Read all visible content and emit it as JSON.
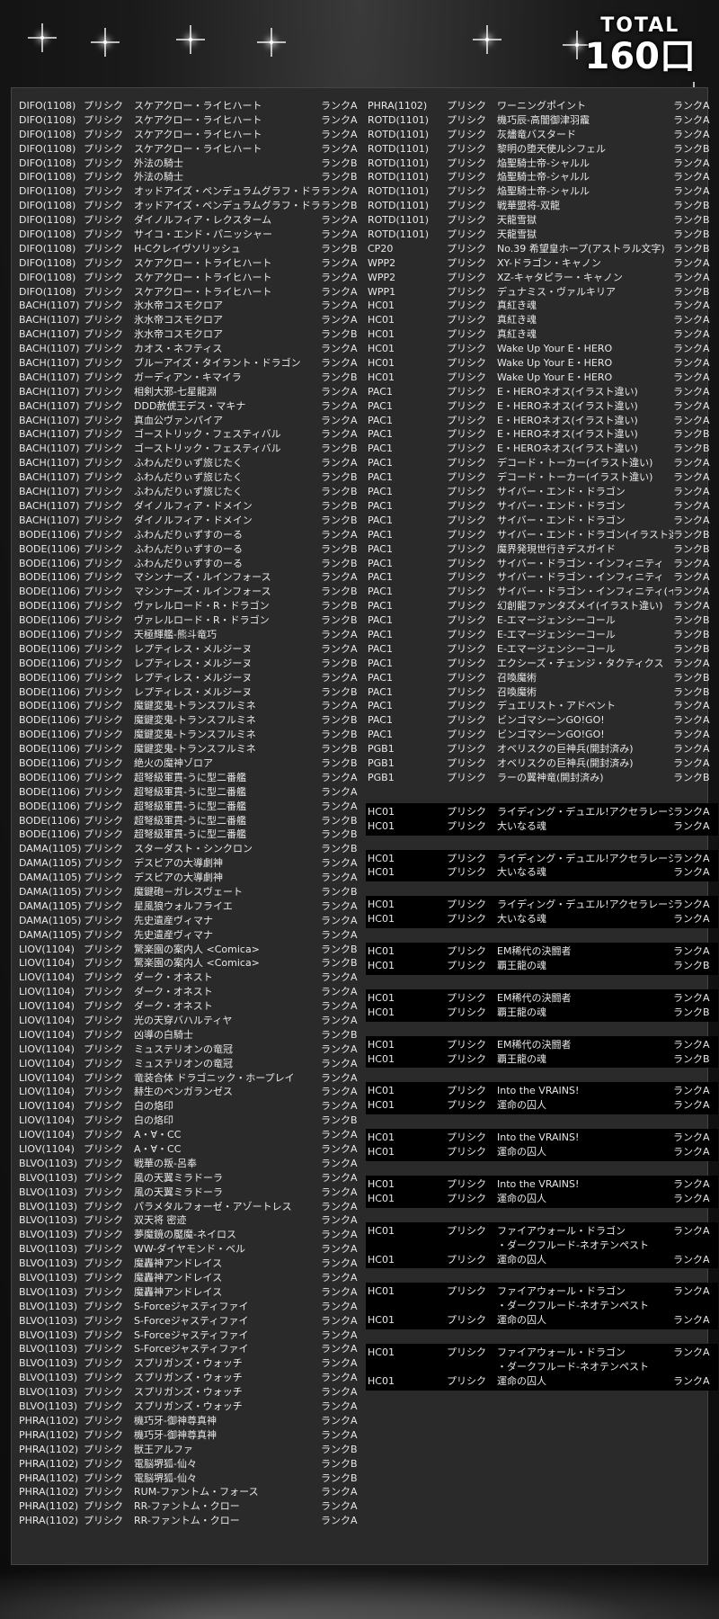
{
  "total": {
    "label": "TOTAL",
    "count": "160口"
  },
  "left_rows": [
    [
      "DIFO(1108)",
      "プリシク",
      "スケアクロー・ライヒハート",
      "ランクA"
    ],
    [
      "DIFO(1108)",
      "プリシク",
      "スケアクロー・ライヒハート",
      "ランクA"
    ],
    [
      "DIFO(1108)",
      "プリシク",
      "スケアクロー・ライヒハート",
      "ランクA"
    ],
    [
      "DIFO(1108)",
      "プリシク",
      "スケアクロー・ライヒハート",
      "ランクA"
    ],
    [
      "DIFO(1108)",
      "プリシク",
      "外法の騎士",
      "ランクB"
    ],
    [
      "DIFO(1108)",
      "プリシク",
      "外法の騎士",
      "ランクB"
    ],
    [
      "DIFO(1108)",
      "プリシク",
      "オッドアイズ・ペンデュラムグラフ・ドラゴン",
      "ランクA"
    ],
    [
      "DIFO(1108)",
      "プリシク",
      "オッドアイズ・ペンデュラムグラフ・ドラゴン",
      "ランクB"
    ],
    [
      "DIFO(1108)",
      "プリシク",
      "ダイノルフィア・レクスターム",
      "ランクA"
    ],
    [
      "DIFO(1108)",
      "プリシク",
      "サイコ・エンド・パニッシャー",
      "ランクA"
    ],
    [
      "DIFO(1108)",
      "プリシク",
      "H-Cクレイヴソリッシュ",
      "ランクB"
    ],
    [
      "DIFO(1108)",
      "プリシク",
      "スケアクロー・トライヒハート",
      "ランクA"
    ],
    [
      "DIFO(1108)",
      "プリシク",
      "スケアクロー・トライヒハート",
      "ランクA"
    ],
    [
      "DIFO(1108)",
      "プリシク",
      "スケアクロー・トライヒハート",
      "ランクA"
    ],
    [
      "BACH(1107)",
      "プリシク",
      "氷水帝コスモクロア",
      "ランクA"
    ],
    [
      "BACH(1107)",
      "プリシク",
      "氷水帝コスモクロア",
      "ランクA"
    ],
    [
      "BACH(1107)",
      "プリシク",
      "氷水帝コスモクロア",
      "ランクB"
    ],
    [
      "BACH(1107)",
      "プリシク",
      "カオス・ネフティス",
      "ランクA"
    ],
    [
      "BACH(1107)",
      "プリシク",
      "ブルーアイズ・タイラント・ドラゴン",
      "ランクA"
    ],
    [
      "BACH(1107)",
      "プリシク",
      "ガーディアン・キマイラ",
      "ランクB"
    ],
    [
      "BACH(1107)",
      "プリシク",
      "相剣大邪-七星龍淵",
      "ランクA"
    ],
    [
      "BACH(1107)",
      "プリシク",
      "DDD赦俿王デス・マキナ",
      "ランクA"
    ],
    [
      "BACH(1107)",
      "プリシク",
      "真血公ヴァンパイア",
      "ランクA"
    ],
    [
      "BACH(1107)",
      "プリシク",
      "ゴーストリック・フェスティバル",
      "ランクA"
    ],
    [
      "BACH(1107)",
      "プリシク",
      "ゴーストリック・フェスティバル",
      "ランクB"
    ],
    [
      "BACH(1107)",
      "プリシク",
      "ふわんだりぃず旅じたく",
      "ランクA"
    ],
    [
      "BACH(1107)",
      "プリシク",
      "ふわんだりぃず旅じたく",
      "ランクB"
    ],
    [
      "BACH(1107)",
      "プリシク",
      "ふわんだりぃず旅じたく",
      "ランクB"
    ],
    [
      "BACH(1107)",
      "プリシク",
      "ダイノルフィア・ドメイン",
      "ランクB"
    ],
    [
      "BACH(1107)",
      "プリシク",
      "ダイノルフィア・ドメイン",
      "ランクB"
    ],
    [
      "BODE(1106)",
      "プリシク",
      "ふわんだりぃずすのーる",
      "ランクA"
    ],
    [
      "BODE(1106)",
      "プリシク",
      "ふわんだりぃずすのーる",
      "ランクB"
    ],
    [
      "BODE(1106)",
      "プリシク",
      "ふわんだりぃずすのーる",
      "ランクB"
    ],
    [
      "BODE(1106)",
      "プリシク",
      "マシンナーズ・ルインフォース",
      "ランクA"
    ],
    [
      "BODE(1106)",
      "プリシク",
      "マシンナーズ・ルインフォース",
      "ランクB"
    ],
    [
      "BODE(1106)",
      "プリシク",
      "ヴァレルロード・R・ドラゴン",
      "ランクB"
    ],
    [
      "BODE(1106)",
      "プリシク",
      "ヴァレルロード・R・ドラゴン",
      "ランクB"
    ],
    [
      "BODE(1106)",
      "プリシク",
      "天極輝艦-熊斗竜巧",
      "ランクA"
    ],
    [
      "BODE(1106)",
      "プリシク",
      "レプティレス・メルジーヌ",
      "ランクA"
    ],
    [
      "BODE(1106)",
      "プリシク",
      "レプティレス・メルジーヌ",
      "ランクB"
    ],
    [
      "BODE(1106)",
      "プリシク",
      "レプティレス・メルジーヌ",
      "ランクA"
    ],
    [
      "BODE(1106)",
      "プリシク",
      "レプティレス・メルジーヌ",
      "ランクB"
    ],
    [
      "BODE(1106)",
      "プリシク",
      "魔鍵変鬼-トランスフルミネ",
      "ランクA"
    ],
    [
      "BODE(1106)",
      "プリシク",
      "魔鍵変鬼-トランスフルミネ",
      "ランクB"
    ],
    [
      "BODE(1106)",
      "プリシク",
      "魔鍵変鬼-トランスフルミネ",
      "ランクB"
    ],
    [
      "BODE(1106)",
      "プリシク",
      "魔鍵変鬼-トランスフルミネ",
      "ランクB"
    ],
    [
      "BODE(1106)",
      "プリシク",
      "絶火の魔神ゾロア",
      "ランクB"
    ],
    [
      "BODE(1106)",
      "プリシク",
      "超弩級軍貫-うに型二番艦",
      "ランクA"
    ],
    [
      "BODE(1106)",
      "プリシク",
      "超弩級軍貫-うに型二番艦",
      "ランクA"
    ],
    [
      "BODE(1106)",
      "プリシク",
      "超弩級軍貫-うに型二番艦",
      "ランクA"
    ],
    [
      "BODE(1106)",
      "プリシク",
      "超弩級軍貫-うに型二番艦",
      "ランクB"
    ],
    [
      "BODE(1106)",
      "プリシク",
      "超弩級軍貫-うに型二番艦",
      "ランクB"
    ],
    [
      "DAMA(1105)",
      "プリシク",
      "スターダスト・シンクロン",
      "ランクB"
    ],
    [
      "DAMA(1105)",
      "プリシク",
      "デスピアの大導劇神",
      "ランクA"
    ],
    [
      "DAMA(1105)",
      "プリシク",
      "デスピアの大導劇神",
      "ランクA"
    ],
    [
      "DAMA(1105)",
      "プリシク",
      "魔鍵砲－ガレスヴェート",
      "ランクB"
    ],
    [
      "DAMA(1105)",
      "プリシク",
      "星風狼ウォルフライエ",
      "ランクA"
    ],
    [
      "DAMA(1105)",
      "プリシク",
      "先史遺産ヴィマナ",
      "ランクA"
    ],
    [
      "DAMA(1105)",
      "プリシク",
      "先史遺産ヴィマナ",
      "ランクA"
    ],
    [
      "LIOV(1104)",
      "プリシク",
      "驚楽園の案内人 <Comica>",
      "ランクB"
    ],
    [
      "LIOV(1104)",
      "プリシク",
      "驚楽園の案内人 <Comica>",
      "ランクB"
    ],
    [
      "LIOV(1104)",
      "プリシク",
      "ダーク・オネスト",
      "ランクA"
    ],
    [
      "LIOV(1104)",
      "プリシク",
      "ダーク・オネスト",
      "ランクA"
    ],
    [
      "LIOV(1104)",
      "プリシク",
      "ダーク・オネスト",
      "ランクA"
    ],
    [
      "LIOV(1104)",
      "プリシク",
      "光の天穿バハルティヤ",
      "ランクA"
    ],
    [
      "LIOV(1104)",
      "プリシク",
      "凶導の白騎士",
      "ランクB"
    ],
    [
      "LIOV(1104)",
      "プリシク",
      "ミュステリオンの竜冠",
      "ランクA"
    ],
    [
      "LIOV(1104)",
      "プリシク",
      "ミュステリオンの竜冠",
      "ランクA"
    ],
    [
      "LIOV(1104)",
      "プリシク",
      "竜装合体 ドラゴニック・ホープレイ",
      "ランクA"
    ],
    [
      "LIOV(1104)",
      "プリシク",
      "赫生のベンガランゼス",
      "ランクA"
    ],
    [
      "LIOV(1104)",
      "プリシク",
      "白の烙印",
      "ランクA"
    ],
    [
      "LIOV(1104)",
      "プリシク",
      "白の烙印",
      "ランクB"
    ],
    [
      "LIOV(1104)",
      "プリシク",
      "A・∀・CC",
      "ランクA"
    ],
    [
      "LIOV(1104)",
      "プリシク",
      "A・∀・CC",
      "ランクA"
    ],
    [
      "BLVO(1103)",
      "プリシク",
      "戦華の叛-呂奉",
      "ランクA"
    ],
    [
      "BLVO(1103)",
      "プリシク",
      "風の天翼ミラドーラ",
      "ランクA"
    ],
    [
      "BLVO(1103)",
      "プリシク",
      "風の天翼ミラドーラ",
      "ランクA"
    ],
    [
      "BLVO(1103)",
      "プリシク",
      "パラメタルフォーゼ・アゾートレス",
      "ランクA"
    ],
    [
      "BLVO(1103)",
      "プリシク",
      "双天将 密迹",
      "ランクA"
    ],
    [
      "BLVO(1103)",
      "プリシク",
      "夢魔鏡の魘魔-ネイロス",
      "ランクA"
    ],
    [
      "BLVO(1103)",
      "プリシク",
      "WW-ダイヤモンド・ベル",
      "ランクA"
    ],
    [
      "BLVO(1103)",
      "プリシク",
      "魔轟神アンドレイス",
      "ランクA"
    ],
    [
      "BLVO(1103)",
      "プリシク",
      "魔轟神アンドレイス",
      "ランクA"
    ],
    [
      "BLVO(1103)",
      "プリシク",
      "魔轟神アンドレイス",
      "ランクA"
    ],
    [
      "BLVO(1103)",
      "プリシク",
      "S-Forceジャスティファイ",
      "ランクA"
    ],
    [
      "BLVO(1103)",
      "プリシク",
      "S-Forceジャスティファイ",
      "ランクA"
    ],
    [
      "BLVO(1103)",
      "プリシク",
      "S-Forceジャスティファイ",
      "ランクA"
    ],
    [
      "BLVO(1103)",
      "プリシク",
      "S-Forceジャスティファイ",
      "ランクA"
    ],
    [
      "BLVO(1103)",
      "プリシク",
      "スプリガンズ・ウォッチ",
      "ランクA"
    ],
    [
      "BLVO(1103)",
      "プリシク",
      "スプリガンズ・ウォッチ",
      "ランクA"
    ],
    [
      "BLVO(1103)",
      "プリシク",
      "スプリガンズ・ウォッチ",
      "ランクA"
    ],
    [
      "BLVO(1103)",
      "プリシク",
      "スプリガンズ・ウォッチ",
      "ランクA"
    ],
    [
      "PHRA(1102)",
      "プリシク",
      "機巧牙-御神尊真神",
      "ランクA"
    ],
    [
      "PHRA(1102)",
      "プリシク",
      "機巧牙-御神尊真神",
      "ランクA"
    ],
    [
      "PHRA(1102)",
      "プリシク",
      "獣王アルファ",
      "ランクB"
    ],
    [
      "PHRA(1102)",
      "プリシク",
      "電脳堺狐-仙々",
      "ランクB"
    ],
    [
      "PHRA(1102)",
      "プリシク",
      "電脳堺狐-仙々",
      "ランクB"
    ],
    [
      "PHRA(1102)",
      "プリシク",
      "RUM-ファントム・フォース",
      "ランクA"
    ],
    [
      "PHRA(1102)",
      "プリシク",
      "RR-ファントム・クロー",
      "ランクA"
    ],
    [
      "PHRA(1102)",
      "プリシク",
      "RR-ファントム・クロー",
      "ランクA"
    ]
  ],
  "right_rows": [
    [
      "PHRA(1102)",
      "プリシク",
      "ワーニングポイント",
      "ランクA"
    ],
    [
      "ROTD(1101)",
      "プリシク",
      "機巧辰-高闇御津羽靇",
      "ランクA"
    ],
    [
      "ROTD(1101)",
      "プリシク",
      "灰燼竜バスタード",
      "ランクA"
    ],
    [
      "ROTD(1101)",
      "プリシク",
      "黎明の堕天使ルシフェル",
      "ランクB"
    ],
    [
      "ROTD(1101)",
      "プリシク",
      "焔聖騎士帝-シャルル",
      "ランクA"
    ],
    [
      "ROTD(1101)",
      "プリシク",
      "焔聖騎士帝-シャルル",
      "ランクA"
    ],
    [
      "ROTD(1101)",
      "プリシク",
      "焔聖騎士帝-シャルル",
      "ランクA"
    ],
    [
      "ROTD(1101)",
      "プリシク",
      "戦華盟将-双龍",
      "ランクB"
    ],
    [
      "ROTD(1101)",
      "プリシク",
      "天龍雪獄",
      "ランクB"
    ],
    [
      "ROTD(1101)",
      "プリシク",
      "天龍雪獄",
      "ランクB"
    ],
    [
      "CP20",
      "プリシク",
      "No.39 希望皇ホープ(アストラル文字)",
      "ランクB"
    ],
    [
      "WPP2",
      "プリシク",
      "XY-ドラゴン・キャノン",
      "ランクA"
    ],
    [
      "WPP2",
      "プリシク",
      "XZ-キャタピラー・キャノン",
      "ランクA"
    ],
    [
      "WPP1",
      "プリシク",
      "デュナミス・ヴァルキリア",
      "ランクB"
    ],
    [
      "HC01",
      "プリシク",
      "真紅き魂",
      "ランクA"
    ],
    [
      "HC01",
      "プリシク",
      "真紅き魂",
      "ランクA"
    ],
    [
      "HC01",
      "プリシク",
      "真紅き魂",
      "ランクA"
    ],
    [
      "HC01",
      "プリシク",
      "Wake Up Your E・HERO",
      "ランクA"
    ],
    [
      "HC01",
      "プリシク",
      "Wake Up Your E・HERO",
      "ランクA"
    ],
    [
      "HC01",
      "プリシク",
      "Wake Up Your E・HERO",
      "ランクA"
    ],
    [
      "PAC1",
      "プリシク",
      "E・HEROネオス(イラスト違い)",
      "ランクA"
    ],
    [
      "PAC1",
      "プリシク",
      "E・HEROネオス(イラスト違い)",
      "ランクA"
    ],
    [
      "PAC1",
      "プリシク",
      "E・HEROネオス(イラスト違い)",
      "ランクA"
    ],
    [
      "PAC1",
      "プリシク",
      "E・HEROネオス(イラスト違い)",
      "ランクB"
    ],
    [
      "PAC1",
      "プリシク",
      "E・HEROネオス(イラスト違い)",
      "ランクB"
    ],
    [
      "PAC1",
      "プリシク",
      "デコード・トーカー(イラスト違い)",
      "ランクA"
    ],
    [
      "PAC1",
      "プリシク",
      "デコード・トーカー(イラスト違い)",
      "ランクA"
    ],
    [
      "PAC1",
      "プリシク",
      "サイバー・エンド・ドラゴン",
      "ランクA"
    ],
    [
      "PAC1",
      "プリシク",
      "サイバー・エンド・ドラゴン",
      "ランクA"
    ],
    [
      "PAC1",
      "プリシク",
      "サイバー・エンド・ドラゴン",
      "ランクA"
    ],
    [
      "PAC1",
      "プリシク",
      "サイバー・エンド・ドラゴン(イラスト違い)",
      "ランクB"
    ],
    [
      "PAC1",
      "プリシク",
      "魔界発現世行きデスガイド",
      "ランクB"
    ],
    [
      "PAC1",
      "プリシク",
      "サイバー・ドラゴン・インフィニティ",
      "ランクA"
    ],
    [
      "PAC1",
      "プリシク",
      "サイバー・ドラゴン・インフィニティ",
      "ランクA"
    ],
    [
      "PAC1",
      "プリシク",
      "サイバー・ドラゴン・インフィニティ(イラスト違い)",
      "ランクA"
    ],
    [
      "PAC1",
      "プリシク",
      "幻創龍ファンタズメイ(イラスト違い)",
      "ランクA"
    ],
    [
      "PAC1",
      "プリシク",
      "E-エマージェンシーコール",
      "ランクB"
    ],
    [
      "PAC1",
      "プリシク",
      "E-エマージェンシーコール",
      "ランクB"
    ],
    [
      "PAC1",
      "プリシク",
      "E-エマージェンシーコール",
      "ランクB"
    ],
    [
      "PAC1",
      "プリシク",
      "エクシーズ・チェンジ・タクティクス",
      "ランクA"
    ],
    [
      "PAC1",
      "プリシク",
      "召喚魔術",
      "ランクB"
    ],
    [
      "PAC1",
      "プリシク",
      "召喚魔術",
      "ランクB"
    ],
    [
      "PAC1",
      "プリシク",
      "デュエリスト・アドベント",
      "ランクA"
    ],
    [
      "PAC1",
      "プリシク",
      "ビンゴマシーンGO!GO!",
      "ランクA"
    ],
    [
      "PAC1",
      "プリシク",
      "ビンゴマシーンGO!GO!",
      "ランクA"
    ],
    [
      "PGB1",
      "プリシク",
      "オベリスクの巨神兵(開封済み)",
      "ランクA"
    ],
    [
      "PGB1",
      "プリシク",
      "オベリスクの巨神兵(開封済み)",
      "ランクA"
    ],
    [
      "PGB1",
      "プリシク",
      "ラーの翼神竜(開封済み)",
      "ランクB"
    ]
  ],
  "groups": [
    [
      [
        "HC01",
        "プリシク",
        "ライディング・デュエル!アクセラレーション!",
        "ランクA"
      ],
      [
        "HC01",
        "プリシク",
        "大いなる魂",
        "ランクA"
      ]
    ],
    [
      [
        "HC01",
        "プリシク",
        "ライディング・デュエル!アクセラレーション!",
        "ランクA"
      ],
      [
        "HC01",
        "プリシク",
        "大いなる魂",
        "ランクA"
      ]
    ],
    [
      [
        "HC01",
        "プリシク",
        "ライディング・デュエル!アクセラレーション!",
        "ランクA"
      ],
      [
        "HC01",
        "プリシク",
        "大いなる魂",
        "ランクA"
      ]
    ],
    [
      [
        "HC01",
        "プリシク",
        "EM稀代の決闘者",
        "ランクA"
      ],
      [
        "HC01",
        "プリシク",
        "覇王龍の魂",
        "ランクB"
      ]
    ],
    [
      [
        "HC01",
        "プリシク",
        "EM稀代の決闘者",
        "ランクA"
      ],
      [
        "HC01",
        "プリシク",
        "覇王龍の魂",
        "ランクB"
      ]
    ],
    [
      [
        "HC01",
        "プリシク",
        "EM稀代の決闘者",
        "ランクA"
      ],
      [
        "HC01",
        "プリシク",
        "覇王龍の魂",
        "ランクB"
      ]
    ],
    [
      [
        "HC01",
        "プリシク",
        "Into the VRAINS!",
        "ランクA"
      ],
      [
        "HC01",
        "プリシク",
        "運命の囚人",
        "ランクA"
      ]
    ],
    [
      [
        "HC01",
        "プリシク",
        "Into the VRAINS!",
        "ランクA"
      ],
      [
        "HC01",
        "プリシク",
        "運命の囚人",
        "ランクA"
      ]
    ],
    [
      [
        "HC01",
        "プリシク",
        "Into the VRAINS!",
        "ランクA"
      ],
      [
        "HC01",
        "プリシク",
        "運命の囚人",
        "ランクA"
      ]
    ],
    [
      [
        "HC01",
        "プリシク",
        "ファイアウォール・ドラゴン",
        "ランクA"
      ],
      [
        "",
        "",
        "・ダークフルード-ネオテンペスト",
        ""
      ],
      [
        "HC01",
        "プリシク",
        "運命の囚人",
        "ランクA"
      ]
    ],
    [
      [
        "HC01",
        "プリシク",
        "ファイアウォール・ドラゴン",
        "ランクA"
      ],
      [
        "",
        "",
        "・ダークフルード-ネオテンペスト",
        ""
      ],
      [
        "HC01",
        "プリシク",
        "運命の囚人",
        "ランクA"
      ]
    ],
    [
      [
        "HC01",
        "プリシク",
        "ファイアウォール・ドラゴン",
        "ランクA"
      ],
      [
        "",
        "",
        "・ダークフルード-ネオテンペスト",
        ""
      ],
      [
        "HC01",
        "プリシク",
        "運命の囚人",
        "ランクA"
      ]
    ]
  ]
}
